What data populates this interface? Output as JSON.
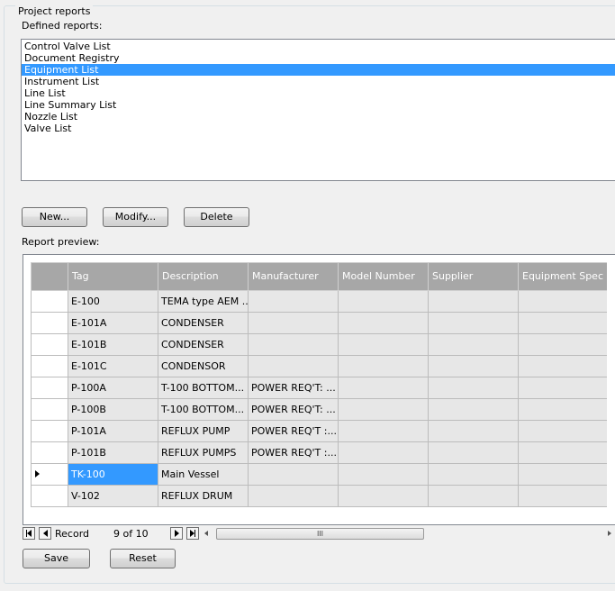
{
  "group": {
    "title": "Project reports"
  },
  "defined_reports": {
    "label_pre": "Defined ",
    "label_u": "r",
    "label_post": "eports:",
    "items": [
      {
        "label": "Control Valve List",
        "selected": false
      },
      {
        "label": "Document Registry",
        "selected": false
      },
      {
        "label": "Equipment List",
        "selected": true
      },
      {
        "label": "Instrument List",
        "selected": false
      },
      {
        "label": "Line List",
        "selected": false
      },
      {
        "label": "Line Summary List",
        "selected": false
      },
      {
        "label": "Nozzle List",
        "selected": false
      },
      {
        "label": "Valve List",
        "selected": false
      }
    ]
  },
  "buttons": {
    "new": {
      "u": "N",
      "rest": "ew..."
    },
    "modify": {
      "u": "M",
      "rest": "odify..."
    },
    "delete": {
      "u": "D",
      "rest": "elete"
    },
    "save": {
      "u": "S",
      "rest": "ave"
    },
    "reset": {
      "u": "R",
      "rest": "eset"
    }
  },
  "report_preview": {
    "label_pre": "Report ",
    "label_u": "p",
    "label_post": "review:",
    "columns": [
      "Tag",
      "Description",
      "Manufacturer",
      "Model Number",
      "Supplier",
      "Equipment Spec"
    ],
    "rows": [
      [
        "E-100",
        "TEMA type AEM ...",
        "",
        "",
        "",
        ""
      ],
      [
        "E-101A",
        "CONDENSER",
        "",
        "",
        "",
        ""
      ],
      [
        "E-101B",
        "CONDENSER",
        "",
        "",
        "",
        ""
      ],
      [
        "E-101C",
        "CONDENSOR",
        "",
        "",
        "",
        ""
      ],
      [
        "P-100A",
        "T-100 BOTTOM...",
        "POWER REQ'T: ...",
        "",
        "",
        ""
      ],
      [
        "P-100B",
        "T-100 BOTTOM...",
        "POWER REQ'T: ...",
        "",
        "",
        ""
      ],
      [
        "P-101A",
        "REFLUX PUMP",
        "POWER REQ'T :...",
        "",
        "",
        ""
      ],
      [
        "P-101B",
        "REFLUX PUMPS",
        "POWER REQ'T :...",
        "",
        "",
        ""
      ],
      [
        "TK-100",
        "Main Vessel",
        "",
        "",
        "",
        ""
      ],
      [
        "V-102",
        "REFLUX DRUM",
        "",
        "",
        "",
        ""
      ]
    ],
    "current_row_index": 8
  },
  "navigator": {
    "record_label": "Record",
    "position": "9 of 10",
    "scroll_grip": "III"
  },
  "colors": {
    "selection": "#3399ff",
    "header_bg": "#a7a7a7",
    "cell_bg": "#e7e7e7"
  }
}
